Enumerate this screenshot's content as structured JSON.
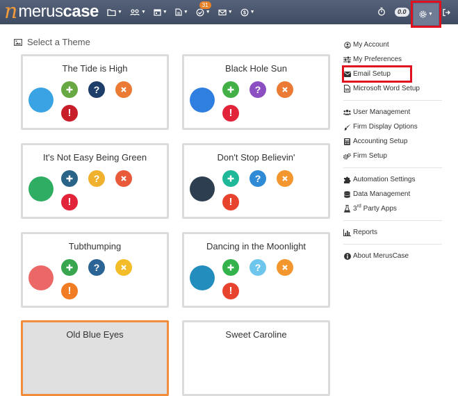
{
  "app": {
    "logo_mark": "n",
    "logo_light": "merus",
    "logo_bold": "case"
  },
  "navbar": {
    "icons": [
      "folder-icon",
      "users-icon",
      "calendar-icon",
      "document-icon",
      "tasks-icon",
      "mail-icon",
      "dollar-icon"
    ],
    "tasks_badge": "31",
    "hours_value": "0.0"
  },
  "themes_section": {
    "title": "Select a Theme",
    "cards": [
      {
        "title": "The Tide is High",
        "swatch": "#3aa3e3",
        "colors": [
          "#68a843",
          "#1d3e68",
          "#ea7a34",
          "#c81e2a"
        ],
        "selected": false
      },
      {
        "title": "Black Hole Sun",
        "swatch": "#2f7fe0",
        "colors": [
          "#43b047",
          "#8c4fc2",
          "#ea7a34",
          "#e2243a"
        ],
        "selected": false
      },
      {
        "title": "It's Not Easy Being Green",
        "swatch": "#2fad63",
        "colors": [
          "#2a6489",
          "#f0b22e",
          "#e85a3a",
          "#e2243a"
        ],
        "selected": false
      },
      {
        "title": "Don't Stop Believin'",
        "swatch": "#2c3e50",
        "colors": [
          "#1fb99a",
          "#2f8bd6",
          "#f3962d",
          "#e8432f"
        ],
        "selected": false
      },
      {
        "title": "Tubthumping",
        "swatch": "#ec6868",
        "colors": [
          "#37a64f",
          "#2d6496",
          "#f3bd29",
          "#f07d24"
        ],
        "selected": false
      },
      {
        "title": "Dancing in the Moonlight",
        "swatch": "#238dbd",
        "colors": [
          "#34b24c",
          "#6fc6ec",
          "#f3962d",
          "#e8432f"
        ],
        "selected": false
      },
      {
        "title": "Old Blue Eyes",
        "swatch": "",
        "colors": [],
        "selected": true
      },
      {
        "title": "Sweet Caroline",
        "swatch": "",
        "colors": [],
        "selected": false
      }
    ]
  },
  "settings_menu": {
    "groups": [
      [
        {
          "label": "My Account",
          "icon": "user-circle-icon"
        },
        {
          "label": "My Preferences",
          "icon": "sliders-icon"
        },
        {
          "label": "Email Setup",
          "icon": "envelope-icon",
          "highlighted": true
        },
        {
          "label": "Microsoft Word Setup",
          "icon": "word-file-icon"
        }
      ],
      [
        {
          "label": "User Management",
          "icon": "users-icon"
        },
        {
          "label": "Firm Display Options",
          "icon": "paint-brush-icon"
        },
        {
          "label": "Accounting Setup",
          "icon": "calculator-icon"
        },
        {
          "label": "Firm Setup",
          "icon": "cogs-icon"
        }
      ],
      [
        {
          "label": "Automation Settings",
          "icon": "puzzle-icon"
        },
        {
          "label": "Data Management",
          "icon": "database-icon"
        },
        {
          "label_pre": "3",
          "label_sup": "rd",
          "label": " Party Apps",
          "icon": "flask-icon"
        }
      ],
      [
        {
          "label": "Reports",
          "icon": "bar-chart-icon"
        }
      ],
      [
        {
          "label": "About MerusCase",
          "icon": "info-circle-icon"
        }
      ]
    ]
  }
}
